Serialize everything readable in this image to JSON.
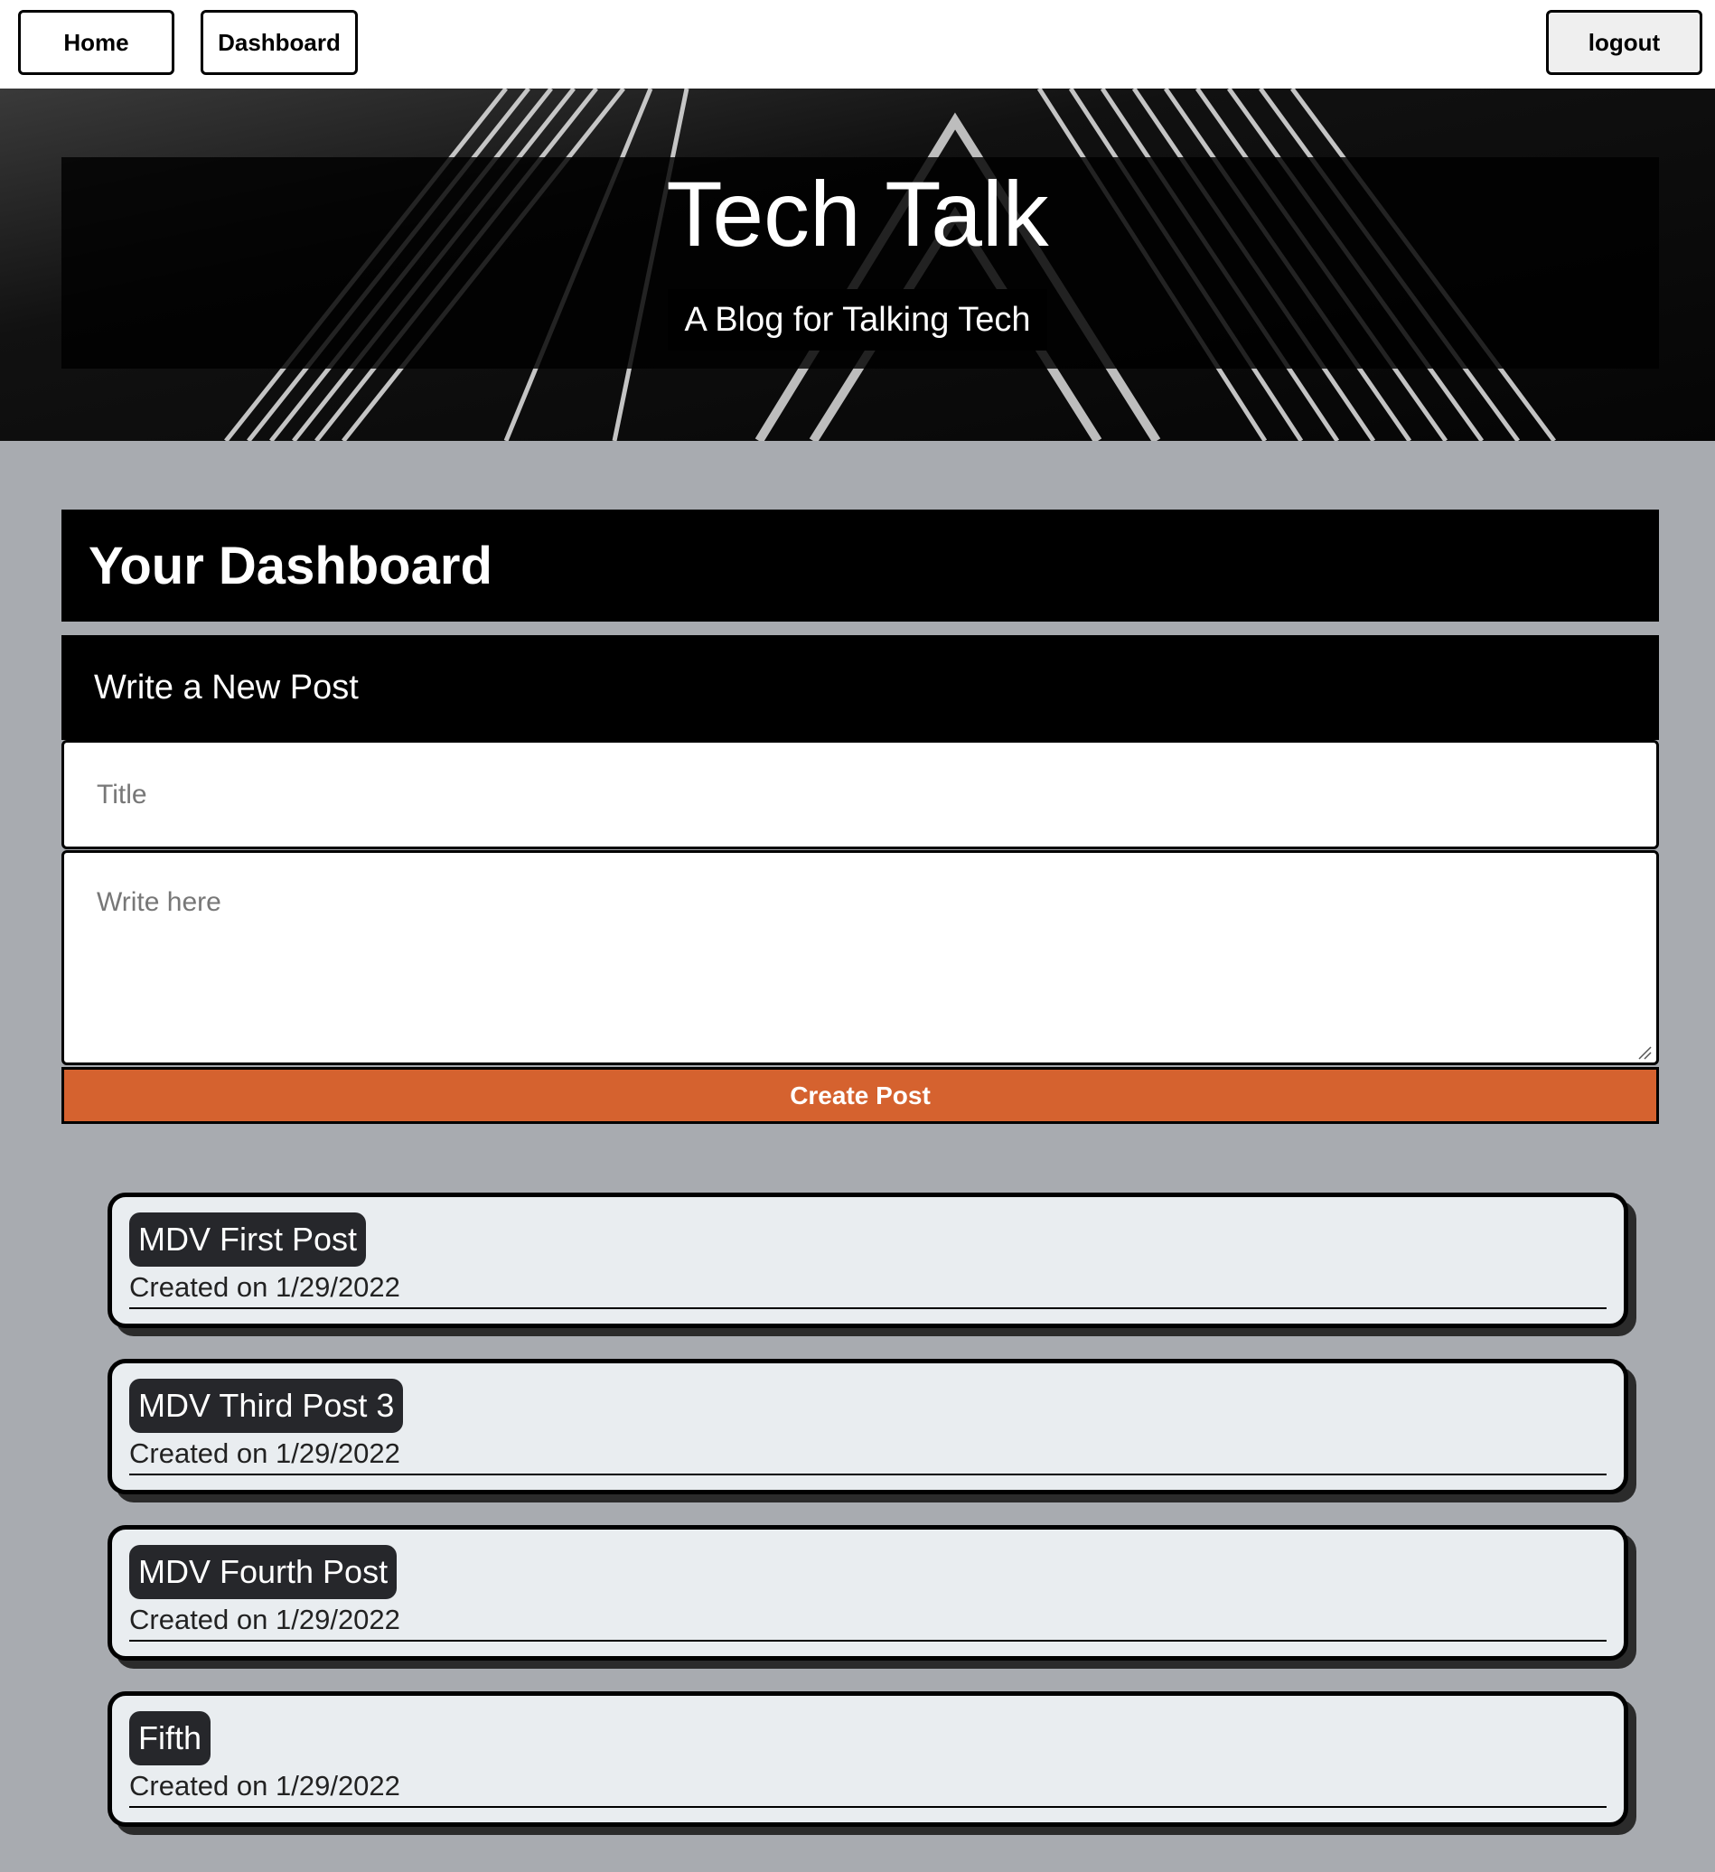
{
  "nav": {
    "home_label": "Home",
    "dashboard_label": "Dashboard",
    "logout_label": "logout"
  },
  "hero": {
    "title": "Tech Talk",
    "subtitle": "A Blog for Talking Tech"
  },
  "dashboard": {
    "heading": "Your Dashboard",
    "form": {
      "heading": "Write a New Post",
      "title_placeholder": "Title",
      "title_value": "",
      "body_placeholder": "Write here",
      "body_value": "",
      "submit_label": "Create Post"
    },
    "posts": [
      {
        "title": "MDV First Post",
        "date": "Created on 1/29/2022"
      },
      {
        "title": "MDV Third Post 3",
        "date": "Created on 1/29/2022"
      },
      {
        "title": "MDV Fourth Post",
        "date": "Created on 1/29/2022"
      },
      {
        "title": "Fifth",
        "date": "Created on 1/29/2022"
      }
    ]
  },
  "colors": {
    "page_background": "#a8abb0",
    "accent_button": "#d5622f",
    "header_background": "#000000",
    "card_background": "#e9edf0",
    "post_title_badge": "#26272b"
  }
}
